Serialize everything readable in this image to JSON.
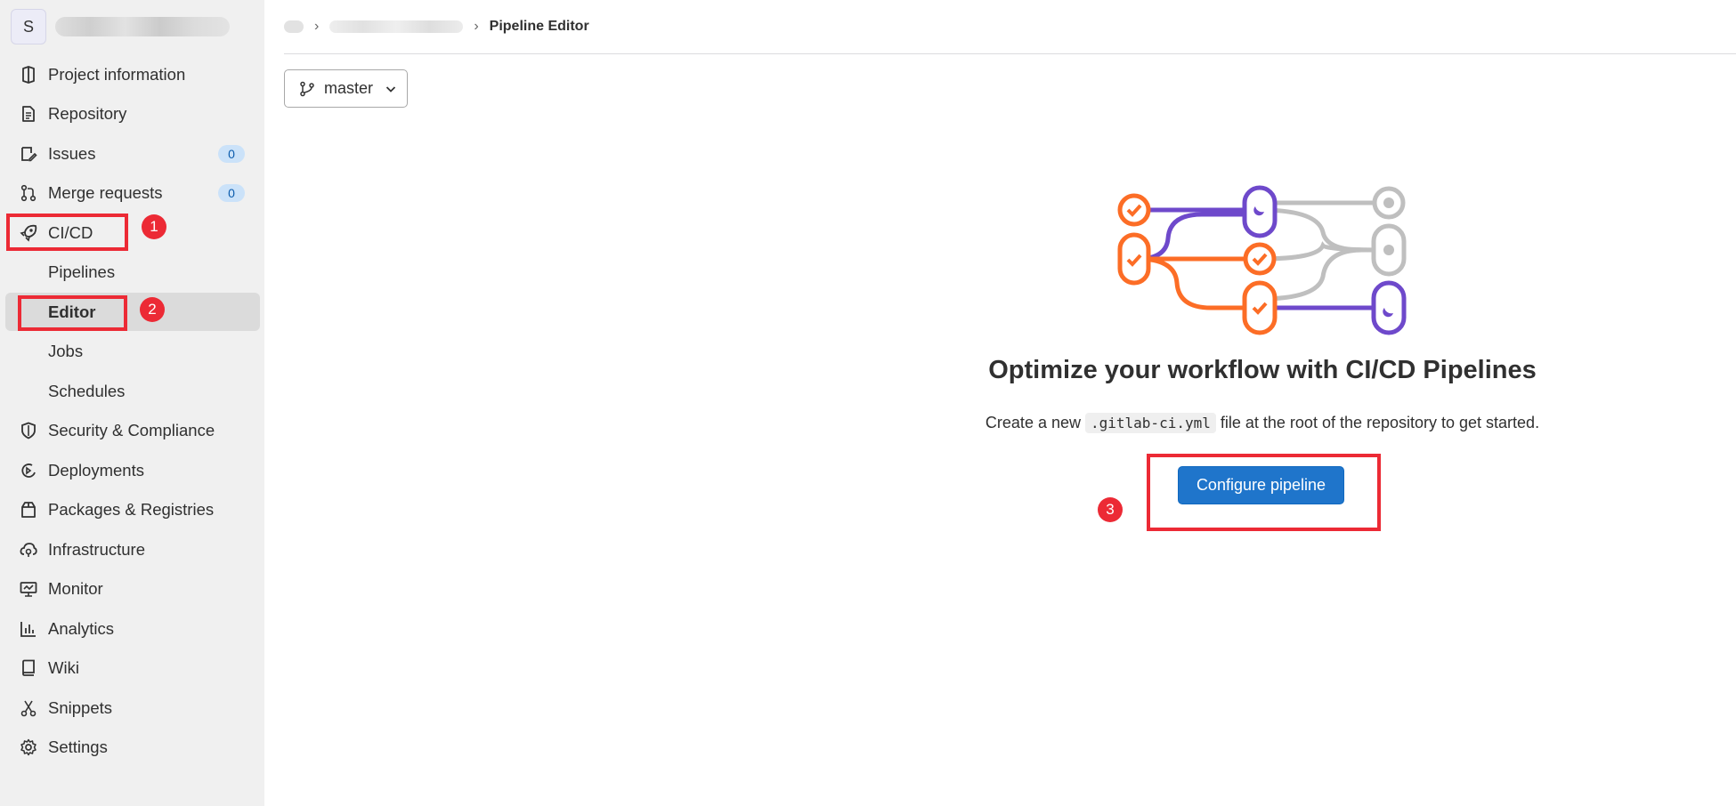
{
  "sidebar": {
    "avatar_letter": "S",
    "items": [
      {
        "label": "Project information",
        "icon": "project-information-icon"
      },
      {
        "label": "Repository",
        "icon": "repository-icon"
      },
      {
        "label": "Issues",
        "icon": "issues-icon",
        "count": "0"
      },
      {
        "label": "Merge requests",
        "icon": "merge-request-icon",
        "count": "0"
      },
      {
        "label": "CI/CD",
        "icon": "rocket-icon"
      },
      {
        "label": "Pipelines"
      },
      {
        "label": "Editor",
        "active": true
      },
      {
        "label": "Jobs"
      },
      {
        "label": "Schedules"
      },
      {
        "label": "Security & Compliance",
        "icon": "shield-icon"
      },
      {
        "label": "Deployments",
        "icon": "deployments-icon"
      },
      {
        "label": "Packages & Registries",
        "icon": "package-icon"
      },
      {
        "label": "Infrastructure",
        "icon": "infrastructure-icon"
      },
      {
        "label": "Monitor",
        "icon": "monitor-icon"
      },
      {
        "label": "Analytics",
        "icon": "analytics-icon"
      },
      {
        "label": "Wiki",
        "icon": "book-icon"
      },
      {
        "label": "Snippets",
        "icon": "scissors-icon"
      },
      {
        "label": "Settings",
        "icon": "settings-gear-icon"
      }
    ]
  },
  "annotations": {
    "step1": "1",
    "step2": "2",
    "step3": "3",
    "color": "#ec2a35"
  },
  "breadcrumb": {
    "current": "Pipeline Editor"
  },
  "branch": {
    "label": "master"
  },
  "empty_state": {
    "title": "Optimize your workflow with CI/CD Pipelines",
    "desc_before": "Create a new",
    "filename": ".gitlab-ci.yml",
    "desc_after": "file at the root of the repository to get started.",
    "button": "Configure pipeline"
  },
  "colors": {
    "primary_button": "#1f75cb",
    "sidebar_bg": "#f0f0f0",
    "orange": "#fc6d26",
    "purple": "#6e49cb",
    "gray": "#bfbfbf"
  }
}
